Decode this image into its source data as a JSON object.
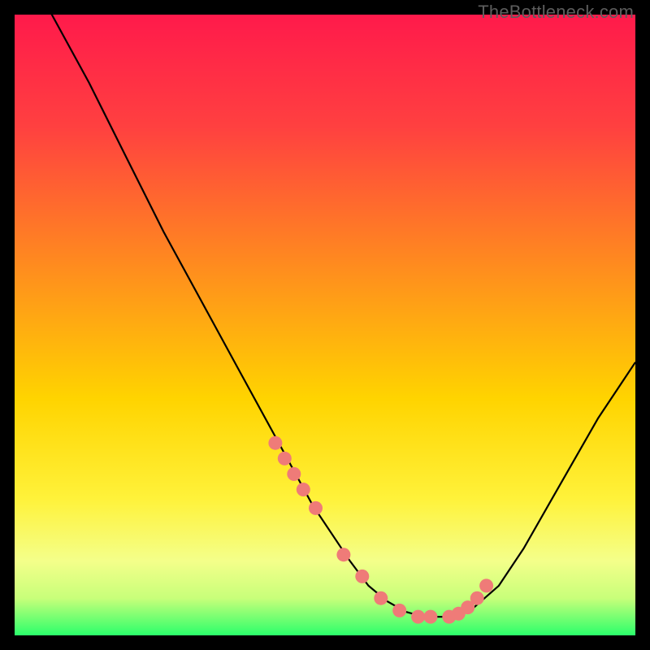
{
  "watermark": "TheBottleneck.com",
  "colors": {
    "gradient_top": "#ff1a4b",
    "gradient_mid1": "#ff8a1f",
    "gradient_mid2": "#ffe600",
    "gradient_mid3": "#f8ff66",
    "gradient_bottom": "#2bff6b",
    "curve": "#000000",
    "marker": "#ef7b78",
    "bg": "#000000"
  },
  "chart_data": {
    "type": "line",
    "title": "",
    "xlabel": "",
    "ylabel": "",
    "xlim": [
      0,
      100
    ],
    "ylim": [
      0,
      100
    ],
    "series": [
      {
        "name": "bottleneck-curve",
        "x": [
          0,
          6,
          12,
          18,
          24,
          30,
          36,
          42,
          48,
          54,
          57,
          60,
          63,
          66,
          70,
          74,
          78,
          82,
          86,
          90,
          94,
          100
        ],
        "y": [
          111,
          100,
          89,
          77,
          65,
          54,
          43,
          32,
          21,
          12,
          8,
          5.5,
          3.8,
          3,
          3,
          4.5,
          8,
          14,
          21,
          28,
          35,
          44
        ]
      }
    ],
    "markers": {
      "name": "highlighted-points",
      "x": [
        42,
        43.5,
        45,
        46.5,
        48.5,
        53,
        56,
        59,
        62,
        65,
        67,
        70,
        71.5,
        73,
        74.5,
        76
      ],
      "y": [
        31,
        28.5,
        26,
        23.5,
        20.5,
        13,
        9.5,
        6,
        4,
        3,
        3,
        3,
        3.5,
        4.5,
        6,
        8
      ]
    }
  }
}
